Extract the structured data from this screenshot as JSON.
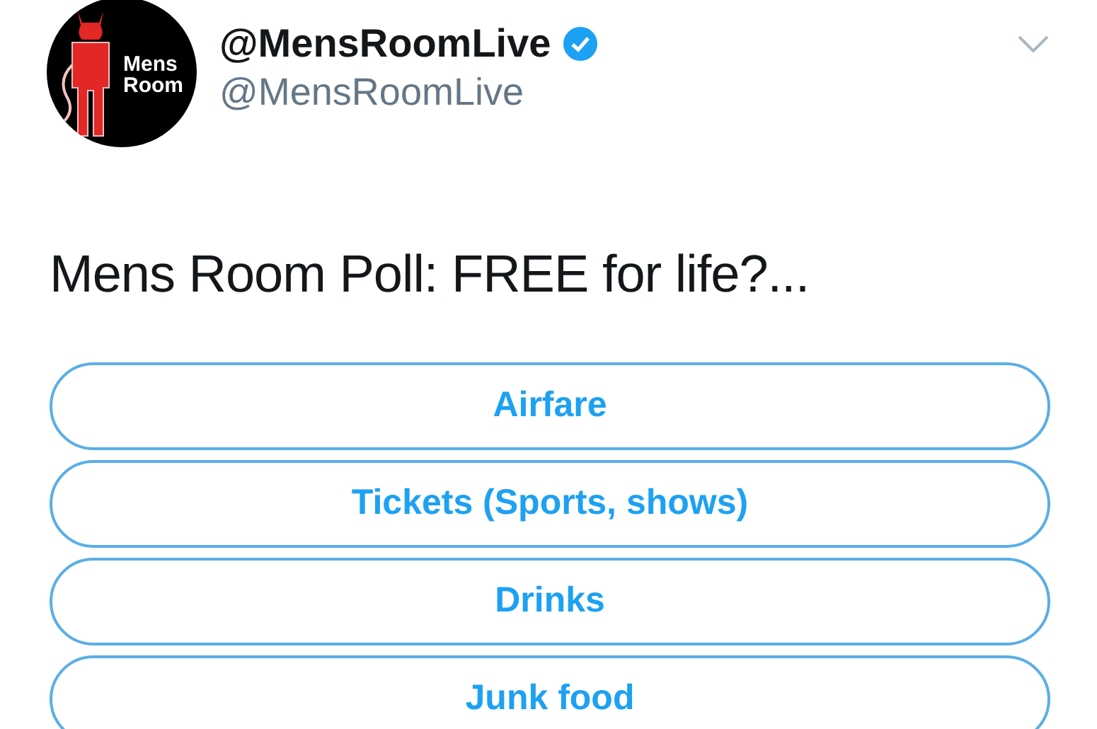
{
  "tweet": {
    "avatar_logo": "Mens Room",
    "display_name": "@MensRoomLive",
    "verified": true,
    "handle": "@MensRoomLive",
    "text": "Mens Room Poll: FREE for life?...",
    "poll_options": [
      {
        "label": "Airfare"
      },
      {
        "label": "Tickets (Sports, shows)"
      },
      {
        "label": "Drinks"
      },
      {
        "label": "Junk food"
      }
    ]
  }
}
